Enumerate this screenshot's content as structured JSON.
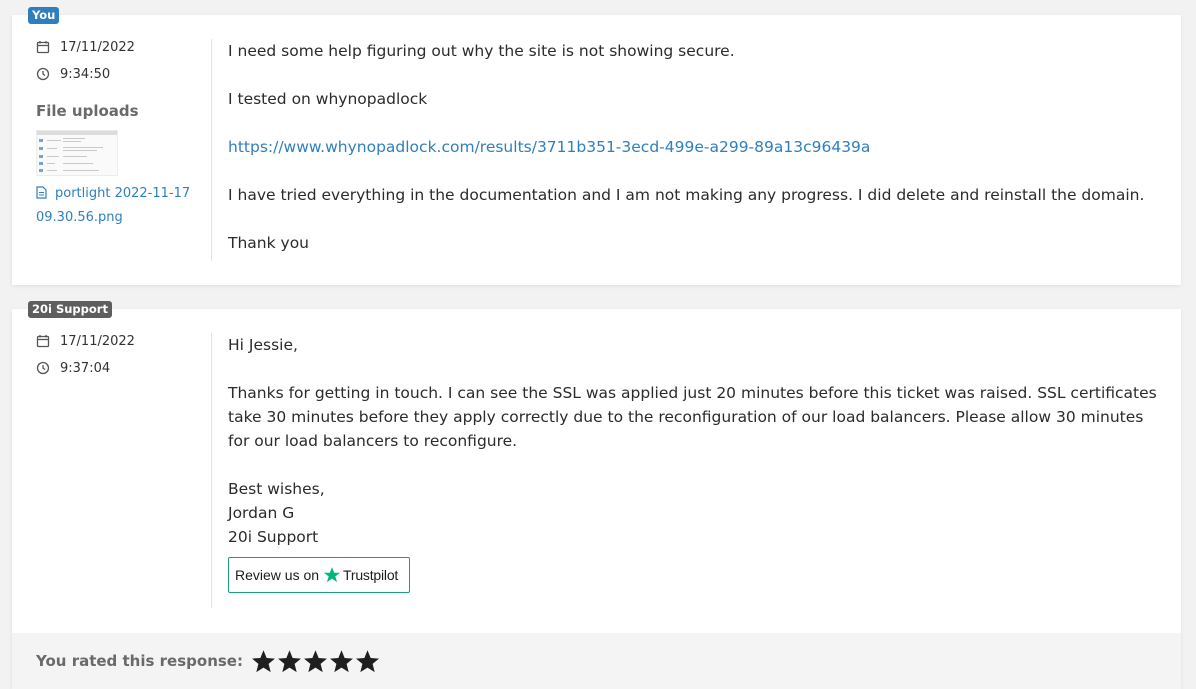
{
  "messages": {
    "customer": {
      "author": "You",
      "date": "17/11/2022",
      "time": "9:34:50",
      "uploads_title": "File uploads",
      "file_name": "portlight 2022-11-17 09.30.56.png",
      "body": {
        "p1": "I need some help figuring out why the site is not showing secure.",
        "p2": "I tested on whynopadlock",
        "link": "https://www.whynopadlock.com/results/3711b351-3ecd-499e-a299-89a13c96439a",
        "p3": "I have tried everything in the documentation and I am not making any progress. I did delete and reinstall the domain.",
        "p4": "Thank you"
      }
    },
    "support": {
      "author": "20i Support",
      "date": "17/11/2022",
      "time": "9:37:04",
      "body": {
        "greeting": "Hi Jessie,",
        "p1": "Thanks for getting in touch. I can see the SSL was applied just 20 minutes before this ticket was raised. SSL certificates take 30 minutes before they apply correctly due to the reconfiguration of our load balancers. Please allow 30 minutes for our load balancers to reconfigure.",
        "signoff": "Best wishes,",
        "name": "Jordan G",
        "team": "20i Support"
      },
      "trustpilot": {
        "prefix": "Review us on",
        "brand": "Trustpilot"
      },
      "rating": {
        "label": "You rated this response:",
        "stars": 5,
        "max_stars": 5
      }
    }
  },
  "colors": {
    "accent": "#2f7fbf",
    "support_badge": "#5e5e5e",
    "trustpilot_green": "#00b67a"
  },
  "icons": {
    "date": "calendar-icon",
    "time": "clock-icon",
    "file": "file-icon",
    "rating": "star-icon"
  }
}
